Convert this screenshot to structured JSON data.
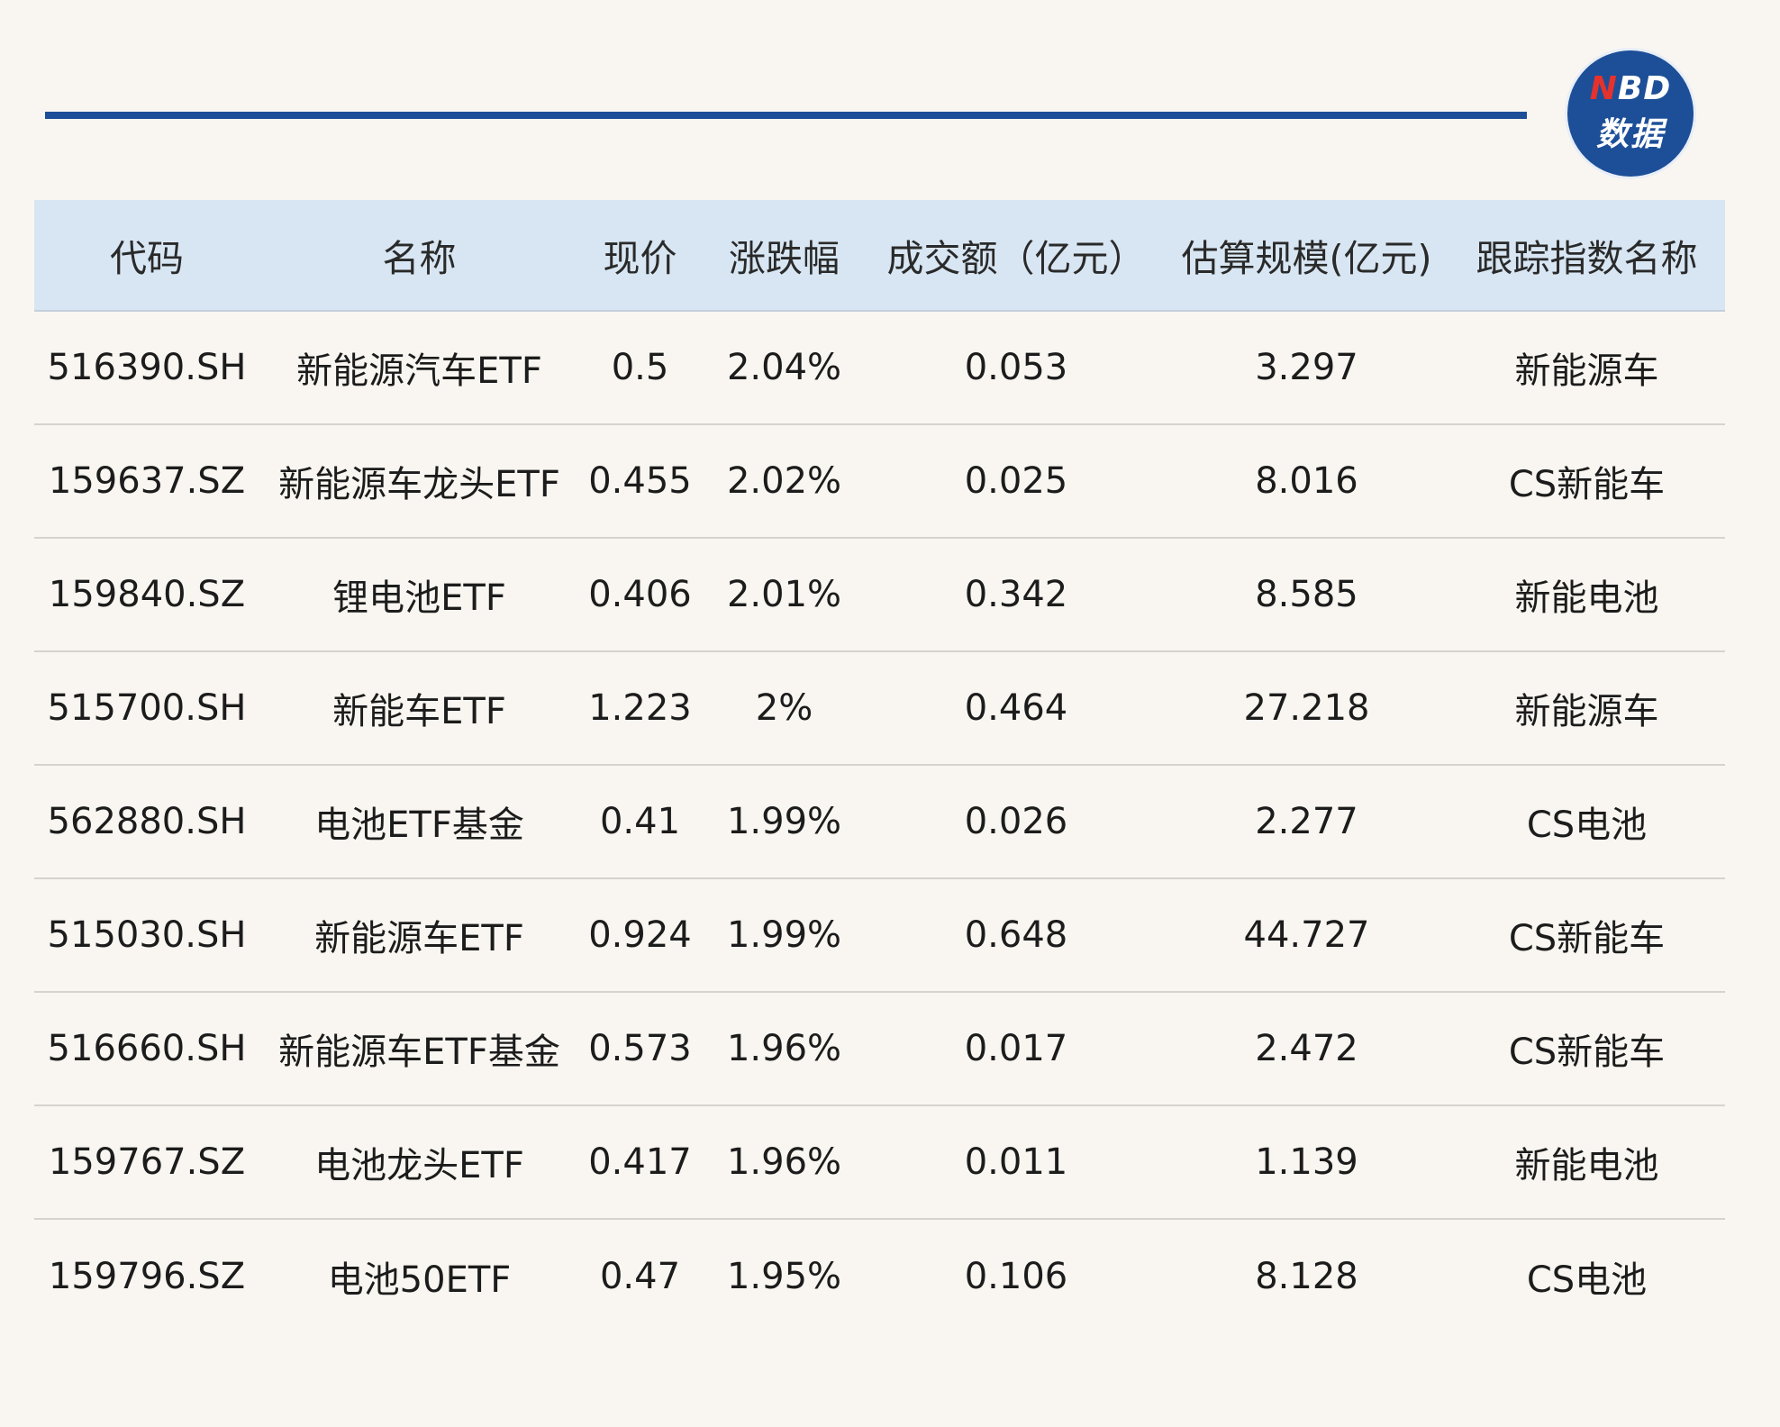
{
  "logo": {
    "brand_n": "N",
    "brand_rest": "BD",
    "subtitle": "数据"
  },
  "table": {
    "headers": [
      "代码",
      "名称",
      "现价",
      "涨跌幅",
      "成交额（亿元）",
      "估算规模(亿元)",
      "跟踪指数名称"
    ],
    "rows": [
      [
        "516390.SH",
        "新能源汽车ETF",
        "0.5",
        "2.04%",
        "0.053",
        "3.297",
        "新能源车"
      ],
      [
        "159637.SZ",
        "新能源车龙头ETF",
        "0.455",
        "2.02%",
        "0.025",
        "8.016",
        "CS新能车"
      ],
      [
        "159840.SZ",
        "锂电池ETF",
        "0.406",
        "2.01%",
        "0.342",
        "8.585",
        "新能电池"
      ],
      [
        "515700.SH",
        "新能车ETF",
        "1.223",
        "2%",
        "0.464",
        "27.218",
        "新能源车"
      ],
      [
        "562880.SH",
        "电池ETF基金",
        "0.41",
        "1.99%",
        "0.026",
        "2.277",
        "CS电池"
      ],
      [
        "515030.SH",
        "新能源车ETF",
        "0.924",
        "1.99%",
        "0.648",
        "44.727",
        "CS新能车"
      ],
      [
        "516660.SH",
        "新能源车ETF基金",
        "0.573",
        "1.96%",
        "0.017",
        "2.472",
        "CS新能车"
      ],
      [
        "159767.SZ",
        "电池龙头ETF",
        "0.417",
        "1.96%",
        "0.011",
        "1.139",
        "新能电池"
      ],
      [
        "159796.SZ",
        "电池50ETF",
        "0.47",
        "1.95%",
        "0.106",
        "8.128",
        "CS电池"
      ]
    ]
  },
  "colors": {
    "accent": "#1d4f98",
    "header_bg": "#d8e6f3",
    "page_bg": "#f9f6f1",
    "logo_n": "#e5322d"
  }
}
